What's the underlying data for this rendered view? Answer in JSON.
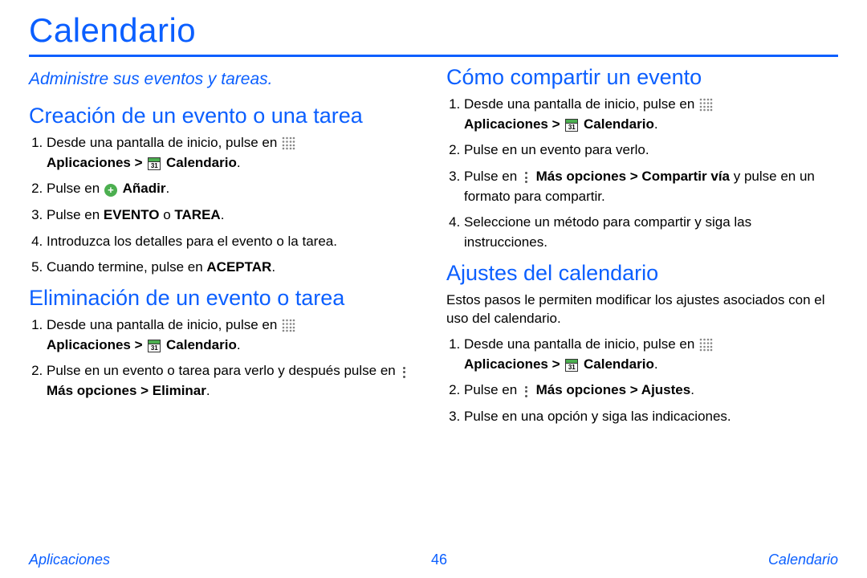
{
  "page": {
    "title": "Calendario",
    "subtitle": "Administre sus eventos y tareas."
  },
  "common": {
    "step_from_home_pre": "Desde una pantalla de inicio, pulse en ",
    "apps_label": "Aplicaciones",
    "gt": " > ",
    "calendar_label": "Calendario",
    "period": ".",
    "tap_prefix": "Pulse en ",
    "mas_opciones": "Más opciones",
    "cal_day": "31"
  },
  "left": {
    "create": {
      "heading": "Creación de un evento o una tarea",
      "add_label": "Añadir",
      "step3_pre": "Pulse en ",
      "step3_evento": "EVENTO",
      "step3_o": " o ",
      "step3_tarea": "TAREA",
      "step4": "Introduzca los detalles para el evento o la tarea.",
      "step5_pre": "Cuando termine, pulse en ",
      "step5_accept": "ACEPTAR"
    },
    "delete": {
      "heading": "Eliminación de un evento o tarea",
      "step2_pre": "Pulse en un evento o tarea para verlo y después pulse en ",
      "step2_path": "Más opciones > Eliminar"
    }
  },
  "right": {
    "share": {
      "heading": "Cómo compartir un evento",
      "step2": "Pulse en un evento para verlo.",
      "step3_path": "Más opciones > Compartir vía",
      "step3_tail": " y pulse en un formato para compartir.",
      "step4": "Seleccione un método para compartir y siga las instrucciones."
    },
    "settings": {
      "heading": "Ajustes del calendario",
      "intro": "Estos pasos le permiten modificar los ajustes asociados con el uso del calendario.",
      "step2_path": "Más opciones > Ajustes",
      "step3": "Pulse en una opción y siga las indicaciones."
    }
  },
  "footer": {
    "left": "Aplicaciones",
    "page_no": "46",
    "right": "Calendario"
  }
}
